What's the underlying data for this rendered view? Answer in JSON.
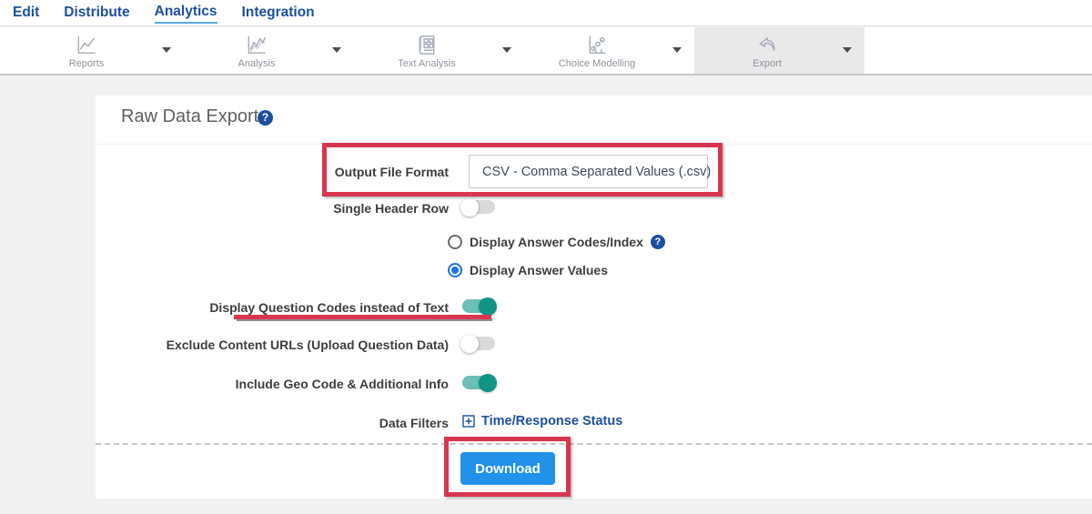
{
  "nav": {
    "items": [
      {
        "label": "Edit",
        "active": false
      },
      {
        "label": "Distribute",
        "active": false
      },
      {
        "label": "Analytics",
        "active": true
      },
      {
        "label": "Integration",
        "active": false
      }
    ]
  },
  "toolbar": {
    "items": [
      {
        "label": "Reports",
        "icon": "line-chart-icon",
        "active": false
      },
      {
        "label": "Analysis",
        "icon": "multi-line-chart-icon",
        "active": false
      },
      {
        "label": "Text Analysis",
        "icon": "newspaper-icon",
        "active": false
      },
      {
        "label": "Choice Modelling",
        "icon": "scatter-chart-icon",
        "active": false
      },
      {
        "label": "Export",
        "icon": "export-arrow-icon",
        "active": true
      }
    ]
  },
  "page": {
    "title": "Raw Data Export",
    "help_icon": "?"
  },
  "form": {
    "output_format": {
      "label": "Output File Format",
      "value": "CSV - Comma Separated Values (.csv)"
    },
    "single_header_row": {
      "label": "Single Header Row",
      "state": "off"
    },
    "answer_display": {
      "options": [
        {
          "label": "Display Answer Codes/Index",
          "selected": false,
          "help_icon": "?"
        },
        {
          "label": "Display Answer Values",
          "selected": true
        }
      ]
    },
    "question_codes": {
      "label": "Display Question Codes instead of Text",
      "state": "on"
    },
    "exclude_urls": {
      "label": "Exclude Content URLs (Upload Question Data)",
      "state": "off"
    },
    "geo_code": {
      "label": "Include Geo Code & Additional Info",
      "state": "on"
    },
    "data_filters": {
      "label": "Data Filters",
      "link_label": "Time/Response Status"
    },
    "download_label": "Download"
  },
  "colors": {
    "nav_blue": "#1d4f9e",
    "nav_underline_blue": "#57a8e1",
    "annotation_red": "#d8354f",
    "download_blue": "#2191ea",
    "toggle_on_teal": "#109485",
    "radio_blue": "#1a73e8"
  }
}
